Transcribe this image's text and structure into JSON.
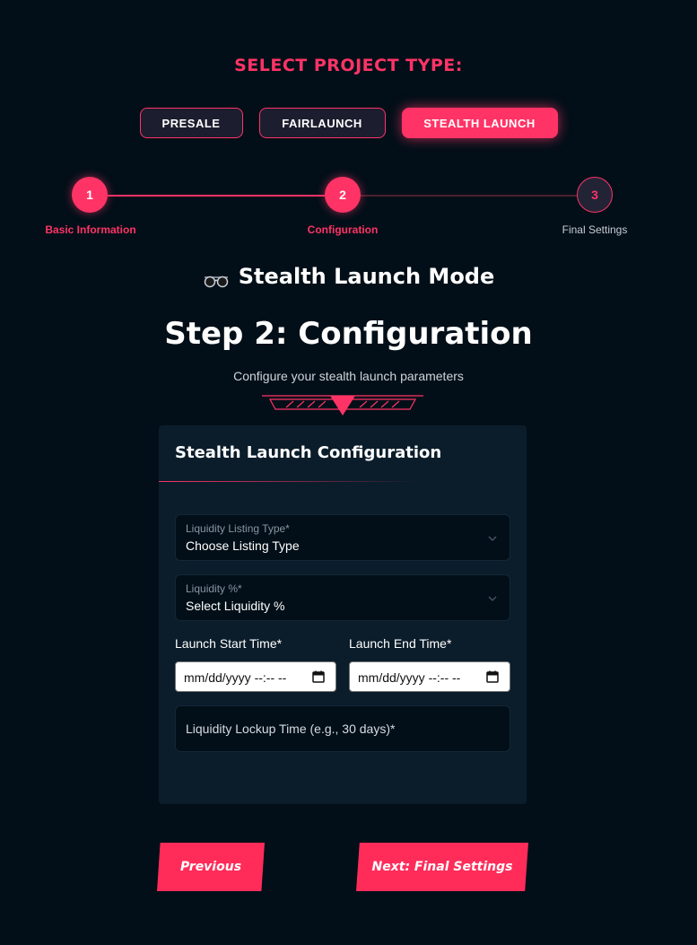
{
  "project_type": {
    "title": "SELECT PROJECT TYPE:",
    "options": [
      "PRESALE",
      "FAIRLAUNCH",
      "STEALTH LAUNCH"
    ],
    "selected": "STEALTH LAUNCH"
  },
  "stepper": {
    "steps": [
      {
        "number": "1",
        "label": "Basic Information",
        "state": "completed"
      },
      {
        "number": "2",
        "label": "Configuration",
        "state": "active"
      },
      {
        "number": "3",
        "label": "Final Settings",
        "state": "pending"
      }
    ]
  },
  "mode": {
    "icon": "glasses-icon",
    "title": "Stealth Launch Mode"
  },
  "page": {
    "title": "Step 2: Configuration",
    "subtitle": "Configure your stealth launch parameters"
  },
  "form": {
    "title": "Stealth Launch Configuration",
    "listing_type": {
      "label": "Liquidity Listing Type*",
      "value": "Choose Listing Type"
    },
    "liquidity_percent": {
      "label": "Liquidity %*",
      "value": "Select Liquidity %"
    },
    "start_time": {
      "label": "Launch Start Time*",
      "value": "mm/dd/yyyy --:-- --"
    },
    "end_time": {
      "label": "Launch End Time*",
      "value": "mm/dd/yyyy --:-- --"
    },
    "lockup_time": {
      "placeholder": "Liquidity Lockup Time (e.g., 30 days)*"
    }
  },
  "nav": {
    "previous": "Previous",
    "next": "Next: Final Settings"
  },
  "colors": {
    "accent": "#ff3366",
    "background": "#020f18",
    "card": "#0b1d2b"
  }
}
